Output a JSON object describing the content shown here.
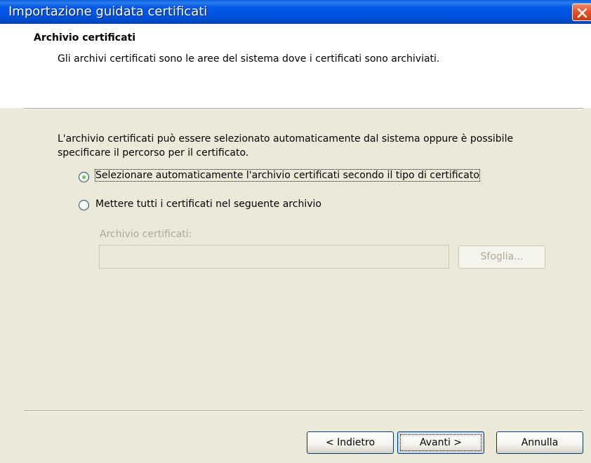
{
  "window": {
    "title": "Importazione guidata certificati"
  },
  "header": {
    "title": "Archivio certificati",
    "subtitle": "Gli archivi certificati sono le aree del sistema dove i certificati sono archiviati."
  },
  "body": {
    "description": "L'archivio certificati può essere selezionato automaticamente dal sistema oppure è possibile specificare il percorso per il certificato.",
    "options": [
      {
        "label": "Selezionare automaticamente l'archivio certificati secondo il tipo di certificato",
        "selected": true
      },
      {
        "label": "Mettere tutti i certificati nel seguente archivio",
        "selected": false
      }
    ],
    "store_field": {
      "label": "Archivio certificati:",
      "value": ""
    },
    "browse_label": "Sfoglia..."
  },
  "footer": {
    "back_label": "< Indietro",
    "next_label": "Avanti >",
    "cancel_label": "Annulla"
  },
  "colors": {
    "titlebar": "#0054e3",
    "dialog_bg": "#ece9d8",
    "disabled_text": "#aca899",
    "close_button": "#e2542d"
  }
}
